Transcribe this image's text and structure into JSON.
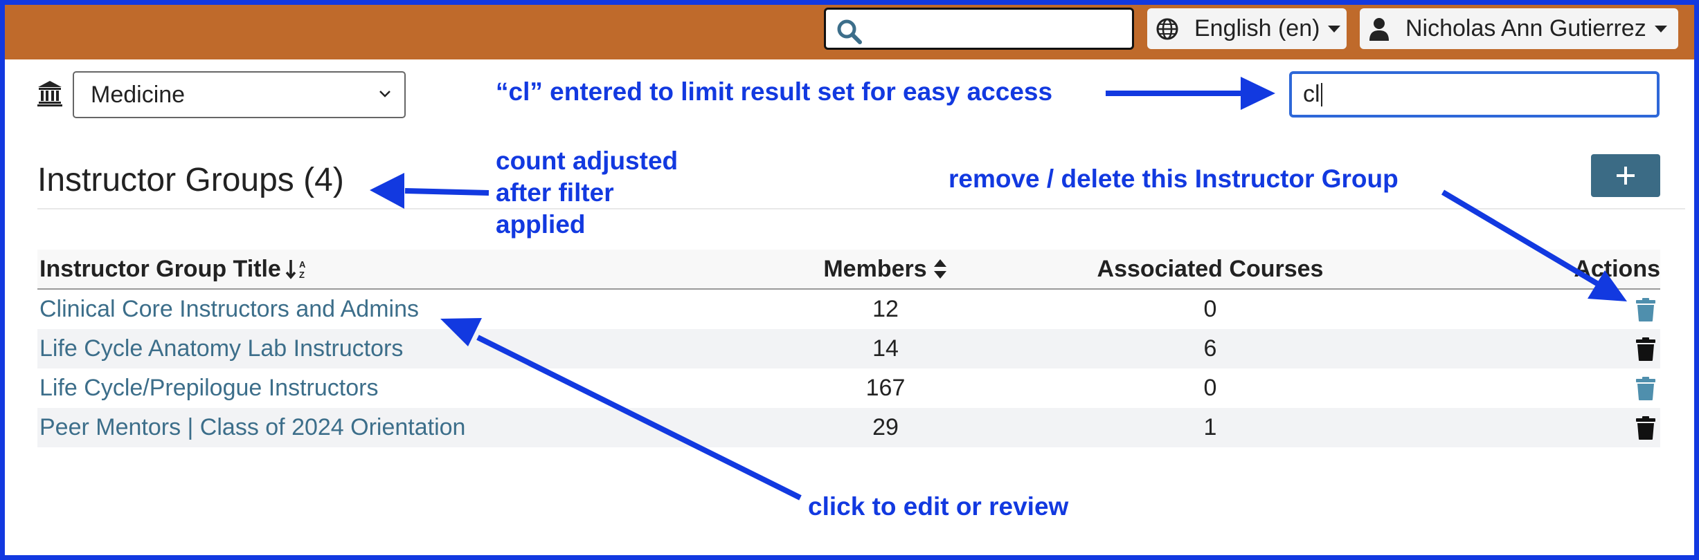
{
  "colors": {
    "topbar": "#bf6a2b",
    "frame": "#1239e0",
    "link": "#3c6e8a",
    "add_button": "#3b6b85",
    "annotation": "#1239e0",
    "trash_teal": "#4f8fad",
    "trash_dark": "#111111"
  },
  "topbar": {
    "search_value": "",
    "search_icon": "search-icon",
    "language_label": "English (en)",
    "language_icon": "globe-icon",
    "user_name": "Nicholas Ann Gutierrez",
    "user_icon": "user-icon"
  },
  "filters": {
    "school_icon": "institution-icon",
    "school_selected": "Medicine",
    "filter_value": "cl"
  },
  "page": {
    "title": "Instructor Groups (4)",
    "add_button_label": "+"
  },
  "table": {
    "headers": {
      "title": "Instructor Group Title",
      "members": "Members",
      "courses": "Associated Courses",
      "actions": "Actions"
    },
    "rows": [
      {
        "title": "Clinical Core Instructors and Admins",
        "members": "12",
        "courses": "0",
        "delete_icon": "trash-icon",
        "delete_color": "#4f8fad"
      },
      {
        "title": "Life Cycle Anatomy Lab Instructors",
        "members": "14",
        "courses": "6",
        "delete_icon": "trash-icon",
        "delete_color": "#111111"
      },
      {
        "title": "Life Cycle/Prepilogue Instructors",
        "members": "167",
        "courses": "0",
        "delete_icon": "trash-icon",
        "delete_color": "#4f8fad"
      },
      {
        "title": "Peer Mentors | Class of 2024 Orientation",
        "members": "29",
        "courses": "1",
        "delete_icon": "trash-icon",
        "delete_color": "#111111"
      }
    ]
  },
  "annotations": {
    "filter_note": "“cl” entered to limit result set for easy access",
    "count_note_1": "count adjusted",
    "count_note_2": "after filter",
    "count_note_3": "applied",
    "delete_note": "remove / delete this Instructor Group",
    "edit_note": "click to edit or review"
  }
}
